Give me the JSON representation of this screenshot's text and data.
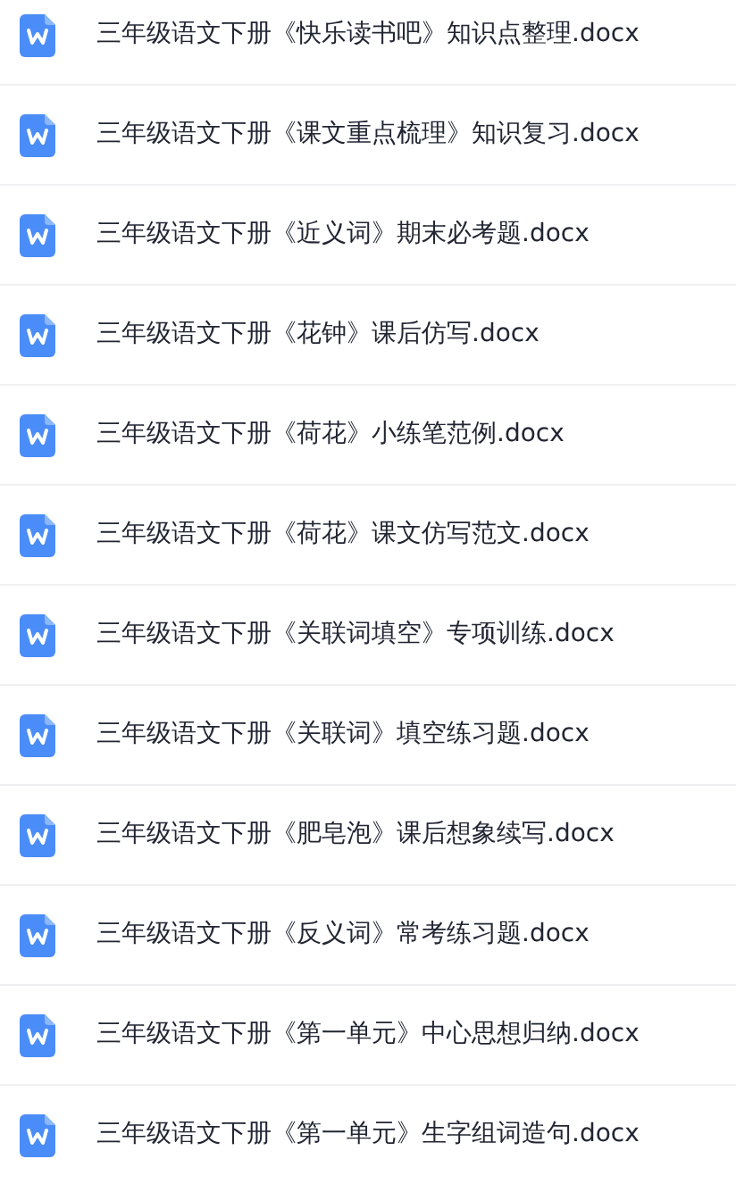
{
  "files": [
    {
      "name": "三年级语文下册《快乐读书吧》知识点整理.docx"
    },
    {
      "name": "三年级语文下册《课文重点梳理》知识复习.docx"
    },
    {
      "name": "三年级语文下册《近义词》期末必考题.docx"
    },
    {
      "name": "三年级语文下册《花钟》课后仿写.docx"
    },
    {
      "name": "三年级语文下册《荷花》小练笔范例.docx"
    },
    {
      "name": "三年级语文下册《荷花》课文仿写范文.docx"
    },
    {
      "name": "三年级语文下册《关联词填空》专项训练.docx"
    },
    {
      "name": "三年级语文下册《关联词》填空练习题.docx"
    },
    {
      "name": "三年级语文下册《肥皂泡》课后想象续写.docx"
    },
    {
      "name": "三年级语文下册《反义词》常考练习题.docx"
    },
    {
      "name": "三年级语文下册《第一单元》中心思想归纳.docx"
    },
    {
      "name": "三年级语文下册《第一单元》生字组词造句.docx"
    }
  ]
}
